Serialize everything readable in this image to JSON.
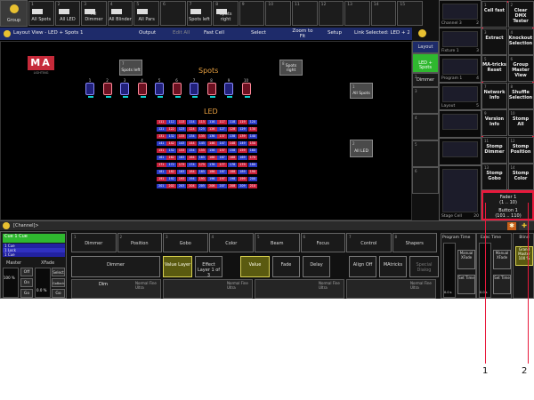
{
  "top_bar": {
    "group_label": "Group",
    "presets": [
      {
        "num": "1",
        "label": "All Spots"
      },
      {
        "num": "2",
        "label": "All LED"
      },
      {
        "num": "3",
        "label": "All Dimmer"
      },
      {
        "num": "4",
        "label": "All Blinder"
      },
      {
        "num": "5",
        "label": "All Pars"
      },
      {
        "num": "6",
        "label": ""
      },
      {
        "num": "7",
        "label": "Spots left"
      },
      {
        "num": "8",
        "label": "Spots right"
      },
      {
        "num": "9",
        "label": ""
      },
      {
        "num": "10",
        "label": ""
      },
      {
        "num": "11",
        "label": ""
      },
      {
        "num": "12",
        "label": ""
      },
      {
        "num": "13",
        "label": ""
      },
      {
        "num": "14",
        "label": ""
      },
      {
        "num": "15",
        "label": ""
      }
    ]
  },
  "layout_view": {
    "title": "Layout View - LED + Spots 1",
    "buttons": [
      "Output",
      "Edit All",
      "Fast Cell",
      "Select",
      "Zoom to Fit",
      "Setup"
    ],
    "link_selected": "Link Selected: LED + 2",
    "logo": "MA",
    "logo_sub": "LIGHTING",
    "spots_label": "Spots",
    "led_label": "LED",
    "spots_left_label": "Spots left",
    "spots_right_label": "Spots right",
    "all_spots_label": "All Spots",
    "all_led_label": "All LED",
    "spots_left_num": "7",
    "spots_right_num": "8",
    "all_spots_num": "1",
    "all_led_num": "2",
    "spot_fixtures": [
      "1",
      "2",
      "3",
      "4",
      "5",
      "6",
      "7",
      "8",
      "9",
      "10"
    ],
    "led_rows": [
      [
        "111",
        "112",
        "113",
        "114",
        "115",
        "116",
        "117",
        "118",
        "119",
        "120"
      ],
      [
        "121",
        "122",
        "123",
        "124",
        "125",
        "126",
        "127",
        "128",
        "129",
        "130"
      ],
      [
        "131",
        "132",
        "133",
        "134",
        "135",
        "136",
        "137",
        "138",
        "139",
        "140"
      ],
      [
        "141",
        "142",
        "143",
        "144",
        "145",
        "146",
        "147",
        "148",
        "149",
        "150"
      ],
      [
        "151",
        "152",
        "153",
        "154",
        "155",
        "156",
        "157",
        "158",
        "159",
        "160"
      ],
      [
        "161",
        "162",
        "163",
        "164",
        "165",
        "166",
        "167",
        "168",
        "169",
        "170"
      ],
      [
        "171",
        "172",
        "173",
        "174",
        "175",
        "176",
        "177",
        "178",
        "179",
        "180"
      ],
      [
        "181",
        "182",
        "183",
        "184",
        "185",
        "186",
        "187",
        "188",
        "189",
        "190"
      ],
      [
        "191",
        "192",
        "193",
        "194",
        "195",
        "196",
        "197",
        "198",
        "199",
        "200"
      ],
      [
        "201",
        "202",
        "203",
        "204",
        "205",
        "206",
        "207",
        "208",
        "209",
        "210"
      ]
    ]
  },
  "view_buttons": [
    {
      "num": "",
      "label": "Layout"
    },
    {
      "num": "",
      "label": "LED + Spots"
    },
    {
      "num": "2",
      "label": "Dimmer"
    },
    {
      "num": "3",
      "label": ""
    },
    {
      "num": "4",
      "label": ""
    },
    {
      "num": "5",
      "label": ""
    },
    {
      "num": "6",
      "label": ""
    }
  ],
  "thumbs": [
    {
      "label": "Channel 3",
      "num": "2"
    },
    {
      "label": "Fixture 1",
      "num": "3"
    },
    {
      "label": "Program 1",
      "num": "4"
    },
    {
      "label": "Layout",
      "num": "5"
    },
    {
      "label": "",
      "num": ""
    },
    {
      "label": "",
      "num": ""
    },
    {
      "label": "Stage Cell",
      "num": "20"
    }
  ],
  "macros": [
    {
      "num": "1",
      "label": "Cell fast"
    },
    {
      "num": "2",
      "label": "Clear DMX Tester"
    },
    {
      "num": "3",
      "label": "Extract"
    },
    {
      "num": "4",
      "label": "Knockout Selection"
    },
    {
      "num": "5",
      "label": "MA-tricks Reset"
    },
    {
      "num": "6",
      "label": "Group Master View"
    },
    {
      "num": "7",
      "label": "Network Info"
    },
    {
      "num": "8",
      "label": "Shuffle Selection"
    },
    {
      "num": "9",
      "label": "Version Info"
    },
    {
      "num": "10",
      "label": "Stomp All"
    },
    {
      "num": "11",
      "label": "Stomp Dimmer"
    },
    {
      "num": "12",
      "label": "Stomp Position"
    },
    {
      "num": "13",
      "label": "Stomp Gobo"
    },
    {
      "num": "14",
      "label": "Stomp Color"
    }
  ],
  "fader_info": {
    "fader": "Fader 1",
    "fader_range": "(1 .. 10)",
    "button": "Button 1",
    "button_range": "(101 .. 110)"
  },
  "command_line": {
    "label": "[Channel]>"
  },
  "exec_panel": {
    "cue_active": "Cue 1 Cue",
    "cues": [
      "1 Cue",
      "1 Lock",
      "1 Cue"
    ],
    "master_label": "Master",
    "xfade_label": "XFade",
    "master_value": "100 %",
    "off": "Off",
    "on": "On",
    "go": "Go",
    "select": "Select",
    "goback": "GoBack",
    "xfade_value": "0.0 %"
  },
  "attr_tabs": [
    {
      "num": "1",
      "label": "Dimmer"
    },
    {
      "num": "2",
      "label": "Position"
    },
    {
      "num": "3",
      "label": "Gobo"
    },
    {
      "num": "4",
      "label": "Color"
    },
    {
      "num": "5",
      "label": "Beam"
    },
    {
      "num": "6",
      "label": "Focus"
    },
    {
      "num": "7",
      "label": "Control"
    },
    {
      "num": "8",
      "label": "Shapers"
    }
  ],
  "function_buttons": [
    "Dimmer",
    "Value Layer",
    "Effect Layer 1 of 3",
    "Value",
    "Fade",
    "Delay",
    "Align Off",
    "MAtricks",
    "Special Dialog"
  ],
  "encoders": [
    {
      "label": "Dim",
      "sub": "Normal Fine Ultra"
    },
    {
      "label": "",
      "sub": "Normal Fine Ultra"
    },
    {
      "label": "",
      "sub": "Normal Fine Ultra"
    },
    {
      "label": "",
      "sub": "Normal Fine Ultra"
    }
  ],
  "program_time": {
    "title": "Program Time",
    "manual": "Manual XFade",
    "set": "Set Time",
    "value": "0.0 s"
  },
  "exec_time": {
    "title": "Exec Time",
    "manual": "Manual XFade",
    "set": "Set Time",
    "value": "0.0 s"
  },
  "grand_master": {
    "title": "Grand Master",
    "value": "100 %",
    "blind": "Blind"
  },
  "annotations": [
    "1",
    "2"
  ],
  "colors": {
    "highlight": "#e8193c",
    "title_bar": "#1e2b6a",
    "selected_green": "#2fb82f",
    "accent_yellow": "#e8c030"
  }
}
